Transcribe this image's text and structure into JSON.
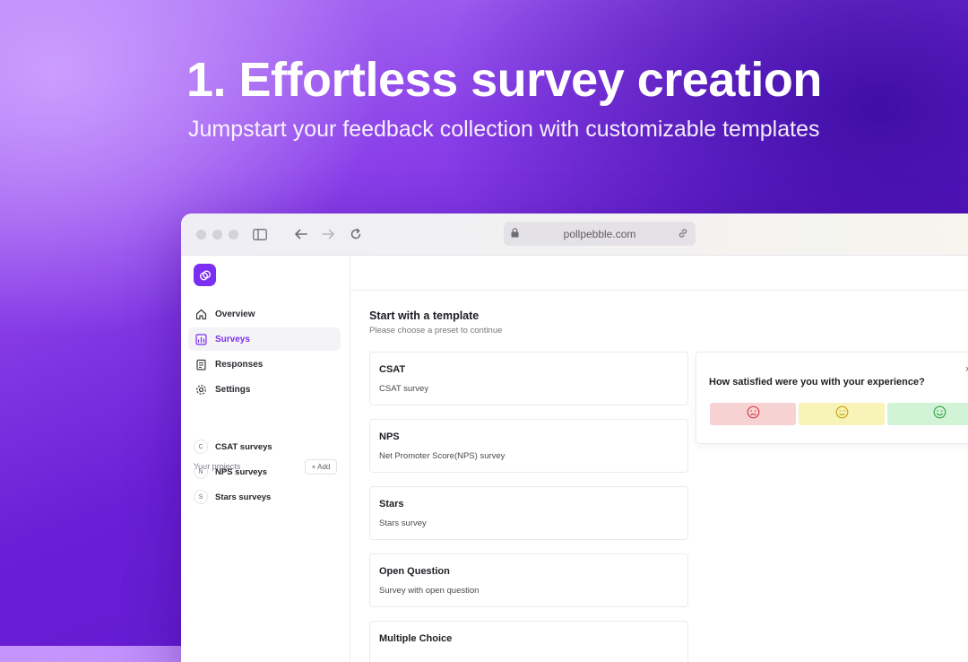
{
  "hero": {
    "title": "1. Effortless survey creation",
    "subtitle": "Jumpstart your feedback collection with customizable templates"
  },
  "browser": {
    "url": "pollpebble.com",
    "icons": [
      "sidebar-icon",
      "back-arrow-icon",
      "forward-arrow-icon",
      "reload-icon",
      "lock-icon",
      "link-icon"
    ]
  },
  "sidebar": {
    "logo_icon": "pollpebble-logo-icon",
    "items": [
      {
        "label": "Overview",
        "icon": "home-icon"
      },
      {
        "label": "Surveys",
        "icon": "chart-icon",
        "active": true
      },
      {
        "label": "Responses",
        "icon": "clipboard-icon"
      },
      {
        "label": "Settings",
        "icon": "gear-icon"
      }
    ],
    "projects_label": "Your projects",
    "add_label": "+ Add",
    "projects": [
      {
        "badge": "C",
        "label": "CSAT surveys"
      },
      {
        "badge": "N",
        "label": "NPS surveys"
      },
      {
        "badge": "S",
        "label": "Stars surveys"
      }
    ]
  },
  "main": {
    "title": "Start with a template",
    "subtitle": "Please choose a preset to continue",
    "templates": [
      {
        "title": "CSAT",
        "desc": "CSAT survey"
      },
      {
        "title": "NPS",
        "desc": "Net Promoter Score(NPS) survey"
      },
      {
        "title": "Stars",
        "desc": "Stars survey"
      },
      {
        "title": "Open Question",
        "desc": "Survey with open question"
      },
      {
        "title": "Multiple Choice",
        "desc": ""
      }
    ]
  },
  "preview": {
    "question": "How satisfied were you with your experience?",
    "close": "×",
    "options": [
      {
        "icon": "sad-face-icon",
        "color": "#f7d2d3"
      },
      {
        "icon": "neutral-face-icon",
        "color": "#f8f3b6"
      },
      {
        "icon": "happy-face-icon",
        "color": "#d3f3d6"
      }
    ]
  },
  "colors": {
    "accent": "#7b2ff2"
  }
}
